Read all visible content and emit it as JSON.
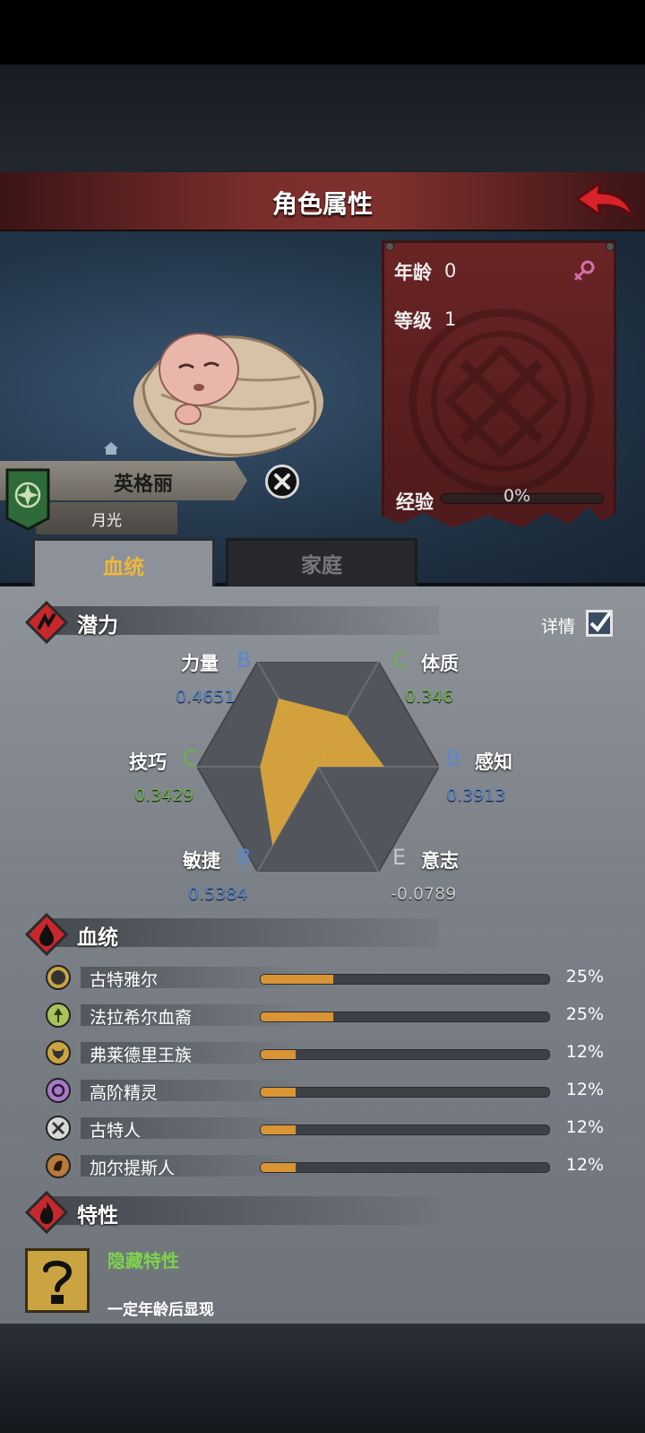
{
  "header": {
    "title": "角色属性",
    "back_icon": "back-arrow-icon"
  },
  "character": {
    "name": "英格丽",
    "title": "月光",
    "age_label": "年龄",
    "age": "0",
    "level_label": "等级",
    "level": "1",
    "exp_label": "经验",
    "exp_value": "0%",
    "exp_fraction": 0.0,
    "gender_icon": "female-symbol-icon"
  },
  "tabs": [
    {
      "label": "血统",
      "active": true
    },
    {
      "label": "家庭",
      "active": false
    }
  ],
  "potential": {
    "title": "潜力",
    "detail_label": "详情",
    "detail_checked": true,
    "attributes": [
      {
        "name": "力量",
        "grade": "B",
        "value": "0.4651"
      },
      {
        "name": "体质",
        "grade": "C",
        "value": "0.346"
      },
      {
        "name": "感知",
        "grade": "B",
        "value": "0.3913"
      },
      {
        "name": "意志",
        "grade": "E",
        "value": "-0.0789"
      },
      {
        "name": "敏捷",
        "grade": "B",
        "value": "0.5384"
      },
      {
        "name": "技巧",
        "grade": "C",
        "value": "0.3429"
      }
    ],
    "colors": {
      "grade_b": "#5b88c9",
      "grade_c": "#6db050",
      "grade_e": "#c8c8c8",
      "radar_fill": "#d9a43a"
    }
  },
  "bloodline": {
    "title": "血统",
    "items": [
      {
        "name": "古特雅尔",
        "percent": "25%",
        "fraction": 0.25
      },
      {
        "name": "法拉希尔血裔",
        "percent": "25%",
        "fraction": 0.25
      },
      {
        "name": "弗莱德里王族",
        "percent": "12%",
        "fraction": 0.12
      },
      {
        "name": "高阶精灵",
        "percent": "12%",
        "fraction": 0.12
      },
      {
        "name": "古特人",
        "percent": "12%",
        "fraction": 0.12
      },
      {
        "name": "加尔提斯人",
        "percent": "12%",
        "fraction": 0.12
      }
    ]
  },
  "traits": {
    "title": "特性",
    "hidden_name": "隐藏特性",
    "hidden_desc": "一定年龄后显现"
  }
}
